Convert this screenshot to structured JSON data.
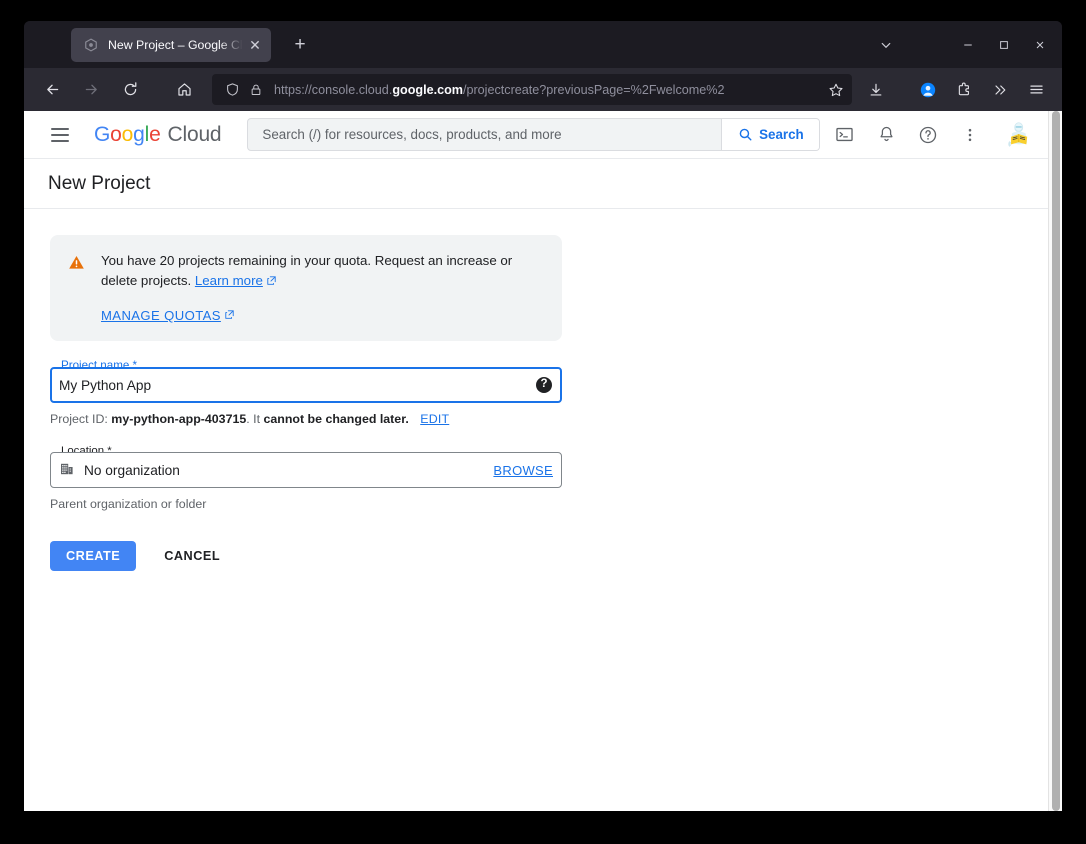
{
  "browser": {
    "tab": {
      "title": "New Project – Google Cloud c",
      "favicon_name": "google-cloud-favicon",
      "close_glyph": "✕"
    },
    "new_tab_glyph": "+",
    "window_controls": {
      "tab_list_glyph": "⌄",
      "minimize_glyph": "–",
      "maximize_glyph": "□",
      "close_glyph": "✕"
    },
    "nav": {
      "back_glyph": "←",
      "forward_glyph": "→",
      "reload_glyph": "⟳",
      "home_glyph": "⌂"
    },
    "url": {
      "prefix": "https://console.cloud.",
      "domain": "google.com",
      "path": "/projectcreate?previousPage=%2Fwelcome%2"
    },
    "toolbar_right": {
      "bookmark": "☆",
      "download": "download-icon",
      "account": "account-icon",
      "extensions": "extensions-icon",
      "overflow": "»",
      "app_menu": "≡"
    }
  },
  "console": {
    "hamburger_label": "Main menu",
    "logo": {
      "g1": "G",
      "o1": "o",
      "o2": "o",
      "g2": "g",
      "l1": "l",
      "e1": "e",
      "word": "Cloud"
    },
    "search": {
      "placeholder": "Search (/) for resources, docs, products, and more",
      "value": "",
      "button_label": "Search"
    },
    "actions": [
      {
        "name": "cloud-shell-icon",
        "label": "Activate Cloud Shell"
      },
      {
        "name": "notifications-bell-icon",
        "label": "Notifications"
      },
      {
        "name": "help-circle-icon",
        "label": "Help"
      },
      {
        "name": "more-vert-icon",
        "label": "More options"
      }
    ],
    "avatar_label": "Account avatar"
  },
  "page": {
    "title": "New Project"
  },
  "alert": {
    "icon": "warning-triangle-icon",
    "text_before_link": "You have 20 projects remaining in your quota. Request an increase or delete projects.",
    "learn_more": "Learn more",
    "external_glyph": "↗",
    "manage_quotas": "MANAGE QUOTAS"
  },
  "form": {
    "project_name": {
      "legend": "Project name *",
      "value": "My Python App",
      "help_badge": "?"
    },
    "project_id_helper": {
      "prefix": "Project ID:",
      "id": "my-python-app-403715",
      "middle": ". It",
      "emphasis": "cannot be changed later.",
      "edit_label": "EDIT"
    },
    "location": {
      "legend": "Location *",
      "icon": "organization-building-icon",
      "value": "No organization",
      "browse_label": "BROWSE",
      "helper": "Parent organization or folder"
    },
    "buttons": {
      "create": "CREATE",
      "cancel": "CANCEL"
    }
  },
  "colors": {
    "accent_blue": "#1a73e8",
    "create_button": "#4285f4",
    "warning_orange": "#e8710a",
    "alert_bg": "#f1f3f4",
    "chrome_tabbar": "#1c1b22",
    "chrome_toolbar": "#2b2a33"
  }
}
